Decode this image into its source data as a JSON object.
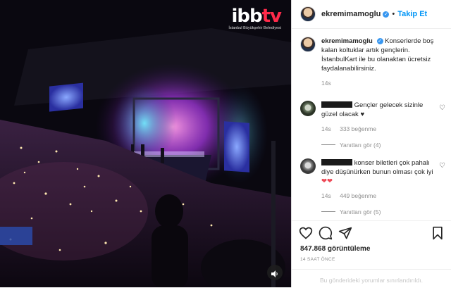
{
  "video": {
    "logo_brand_main": "ibb",
    "logo_brand_tv": "tv",
    "logo_sub": "İstanbul Büyükşehir Belediyesi",
    "sound_icon": "speaker-icon"
  },
  "header": {
    "username": "ekremimamoglu",
    "separator": "•",
    "follow_label": "Takip Et"
  },
  "caption": {
    "username": "ekremimamoglu",
    "text": "Konserlerde boş kalan koltuklar artık gençlerin. İstanbulKart ile bu olanaktan ücretsiz faydalanabilirsiniz.",
    "time": "14s"
  },
  "comments": [
    {
      "text": "Gençler gelecek sizinle güzel olacak ♥",
      "time": "14s",
      "likes": "333 beğenme",
      "replies": "Yanıtları gör (4)"
    },
    {
      "text": "konser biletleri çok pahalı diye düşünürken bunun olması çok iyi",
      "hearts": "❤❤",
      "time": "14s",
      "likes": "449 beğenme",
      "replies": "Yanıtları gör (5)"
    }
  ],
  "footer": {
    "views": "847.868 görüntüleme",
    "ago": "14 SAAT ÖNCE",
    "limited": "Bu gönderideki yorumlar sınırlandırıldı."
  },
  "colors": {
    "accent": "#0095f6",
    "verified": "#3897f0",
    "heart": "#ed4956"
  }
}
